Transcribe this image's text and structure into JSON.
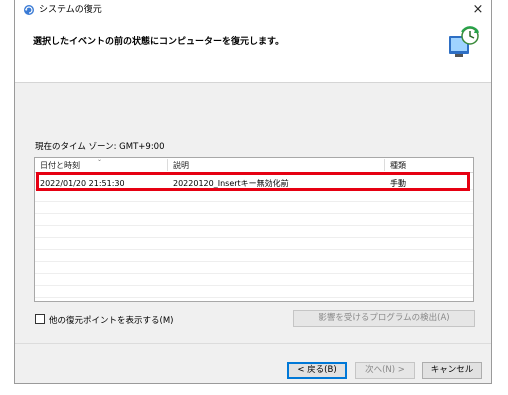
{
  "window": {
    "title": "システムの復元",
    "close": "×"
  },
  "header": {
    "instruction": "選択したイベントの前の状態にコンピューターを復元します。"
  },
  "timezone": "現在のタイム ゾーン: GMT+9:00",
  "table": {
    "columns": [
      "日付と時刻",
      "説明",
      "種類"
    ],
    "rows": [
      {
        "date": "2022/01/20 21:51:30",
        "description": "20220120_Insertキー無効化前",
        "type": "手動"
      }
    ]
  },
  "show_more_points": {
    "label": "他の復元ポイントを表示する(M)",
    "checked": false
  },
  "buttons": {
    "detect": "影響を受けるプログラムの検出(A)",
    "back": "< 戻る(B)",
    "next": "次へ(N) >",
    "cancel": "キャンセル"
  },
  "colors": {
    "highlight": "#e60012",
    "primary_border": "#0078d7"
  }
}
